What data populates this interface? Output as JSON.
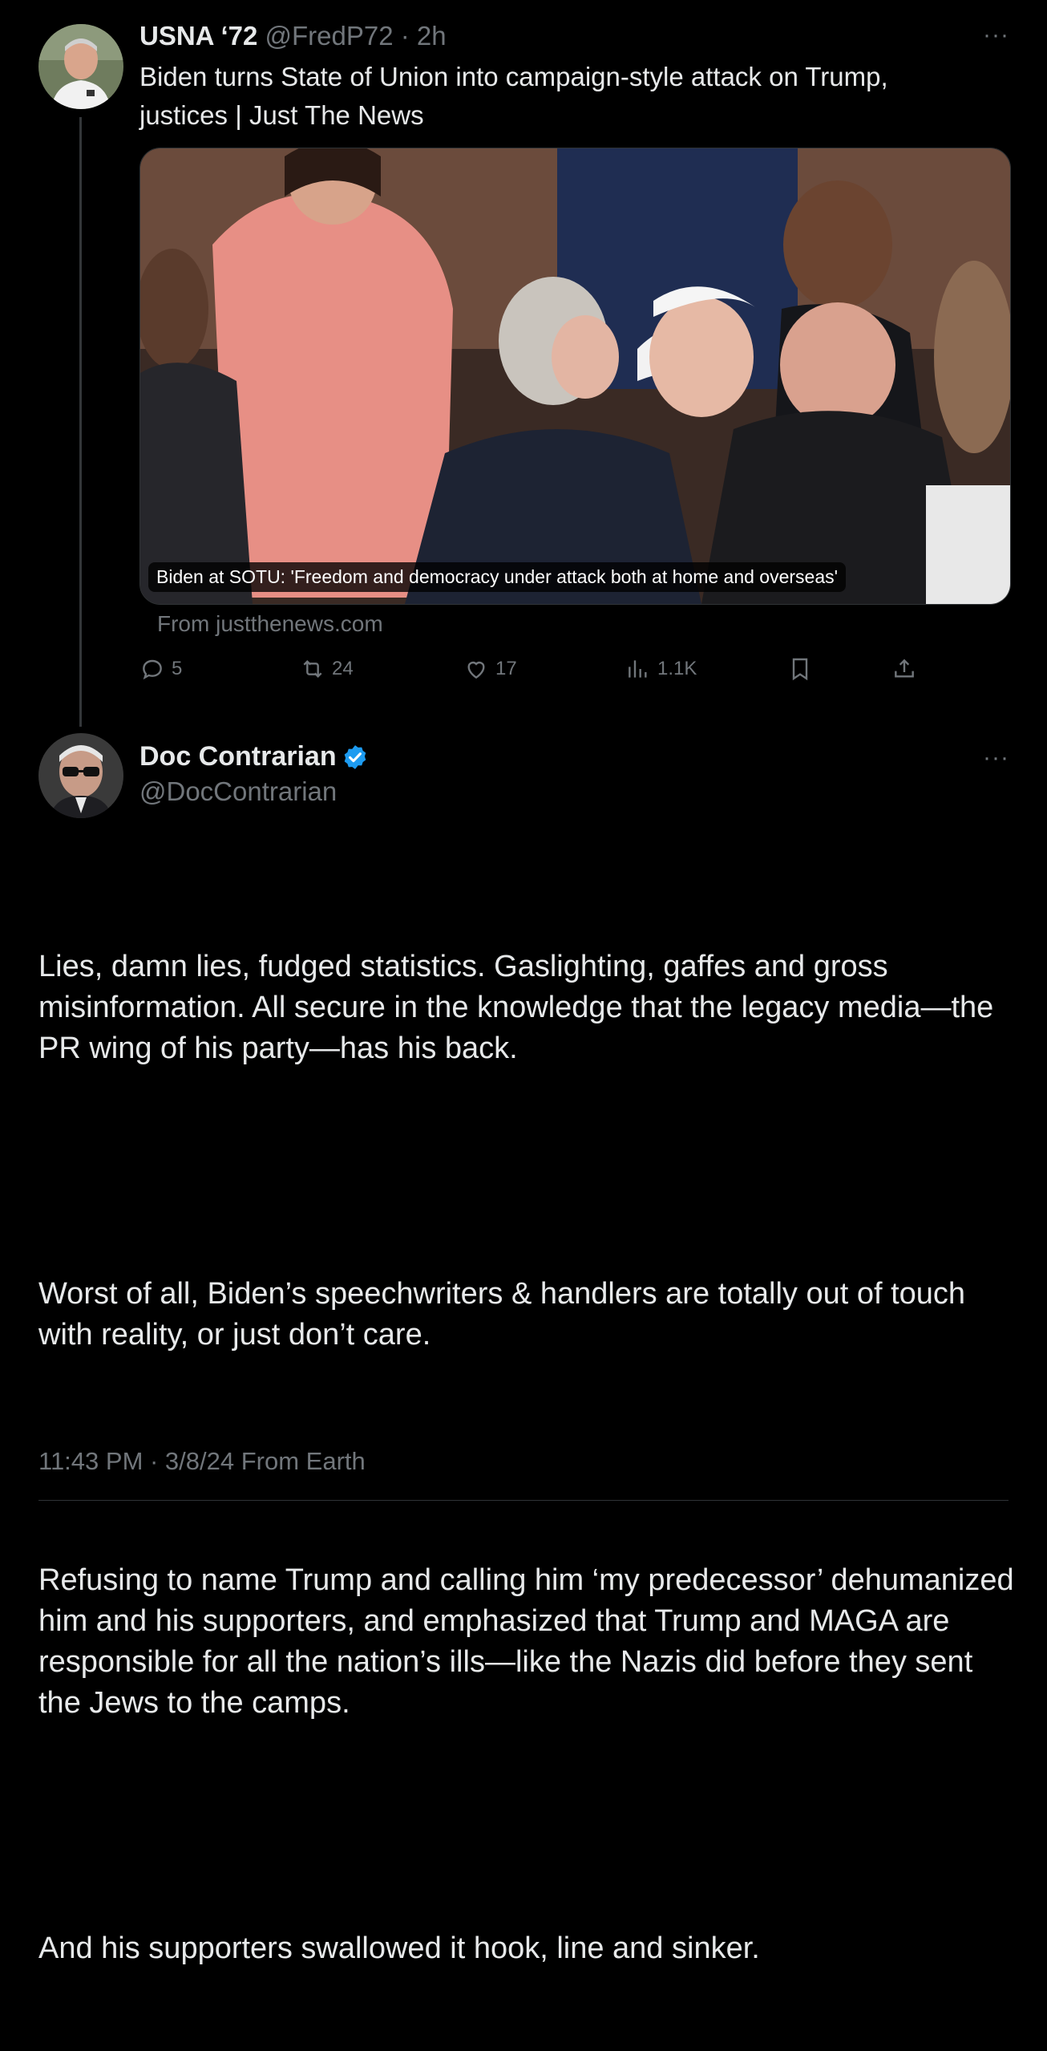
{
  "reply_parent": {
    "display_name": "USNA ‘72",
    "handle": "@FredP72",
    "time": "· 2h",
    "text": "Biden turns State of Union into campaign-style attack on Trump, justices | Just The News",
    "link_card": {
      "caption": "Biden at SOTU: 'Freedom and democracy under attack both at home and overseas'",
      "source": "From justthenews.com"
    },
    "actions": {
      "replies": "5",
      "reposts": "24",
      "likes": "17",
      "views": "1.1K"
    },
    "more_label": "···"
  },
  "main_post": {
    "display_name": "Doc Contrarian",
    "handle": "@DocContrarian",
    "verified": true,
    "more_label": "···",
    "paragraphs": [
      "Lies, damn lies, fudged statistics. Gaslighting, gaffes and gross misinformation. All secure in the knowledge that the legacy media—the PR wing of his party—has his back.",
      "Worst of all, Biden’s speechwriters & handlers are totally out of touch with reality, or just don’t care.",
      "Refusing to name Trump and calling him ‘my predecessor’ dehumanized him and his supporters, and emphasized that Trump and MAGA are responsible for all the nation’s ills—like the Nazis did before they sent the Jews to the camps.",
      "And his supporters swallowed it hook, line and sinker."
    ],
    "meta": "11:43 PM · 3/8/24 From Earth"
  },
  "colors": {
    "background": "#000000",
    "text": "#e7e9ea",
    "muted": "#71767b",
    "verified": "#1d9bf0",
    "divider": "#2f3336"
  }
}
